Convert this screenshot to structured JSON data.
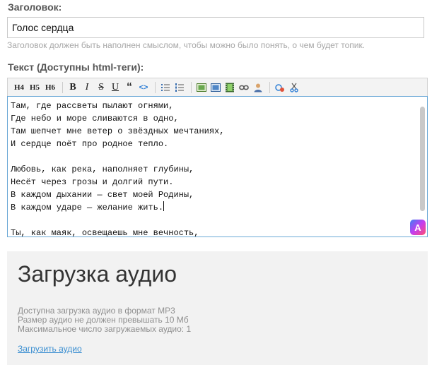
{
  "form": {
    "title_label": "Заголовок:",
    "title_value": "Голос сердца",
    "title_hint": "Заголовок должен быть наполнен смыслом, чтобы можно было понять, о чем будет топик.",
    "text_label": "Текст (Доступны html-теги):"
  },
  "toolbar": {
    "h4": "H4",
    "h5": "H5",
    "h6": "H6",
    "bold": "B",
    "italic": "I",
    "strike": "S",
    "underline": "U",
    "quote": "“",
    "code": "<>"
  },
  "editor": {
    "lines": [
      "Там, где рассветы пылают огнями,",
      "Где небо и море сливаются в одно,",
      "Там шепчет мне ветер о звёздных мечтаниях,",
      "И сердце поёт про родное тепло.",
      "",
      "Любовь, как река, наполняет глубины,",
      "Неcёт через грозы и долгий пути.",
      "В каждом дыхании — свет моей Родины,",
      "В каждом ударе — желание жить.",
      "",
      "Ты, как маяк, освещаешь мне вечность,"
    ]
  },
  "upload": {
    "title": "Загрузка аудио",
    "info": [
      "Доступна загрузка аудио в формат MP3",
      "Размер аудио не должен превышать 10 Мб",
      "Максимальное число загружаемых аудио: 1"
    ],
    "link": "Загрузить аудио"
  },
  "colors": {
    "accent": "#3b8fd1",
    "focus_border": "#6aa8d6",
    "panel_bg": "#f2f2f2"
  }
}
